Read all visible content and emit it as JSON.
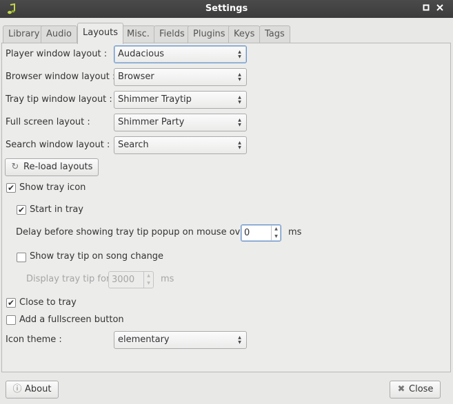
{
  "window": {
    "title": "Settings"
  },
  "tabs": [
    "Library",
    "Audio",
    "Layouts",
    "Misc.",
    "Fields",
    "Plugins",
    "Keys",
    "Tags"
  ],
  "layouts": {
    "player_label": "Player window layout :",
    "player_value": "Audacious",
    "browser_label": "Browser window layout :",
    "browser_value": "Browser",
    "traytip_label": "Tray tip window layout :",
    "traytip_value": "Shimmer Traytip",
    "fullscreen_label": "Full screen layout :",
    "fullscreen_value": "Shimmer Party",
    "search_label": "Search window layout :",
    "search_value": "Search",
    "reload_label": "Re-load layouts"
  },
  "tray": {
    "show_tray_icon": "Show tray icon",
    "start_in_tray": "Start in tray",
    "delay_label": "Delay before showing tray tip popup on mouse over :",
    "delay_value": "0",
    "delay_unit": "ms",
    "show_tip_on_song_change": "Show tray tip on song change",
    "display_for_label": "Display tray tip for",
    "display_for_value": "3000",
    "display_for_unit": "ms",
    "close_to_tray": "Close to tray",
    "fullscreen_button": "Add a fullscreen button"
  },
  "icon_theme": {
    "label": "Icon theme :",
    "value": "elementary"
  },
  "footer": {
    "about": "About",
    "close": "Close"
  }
}
